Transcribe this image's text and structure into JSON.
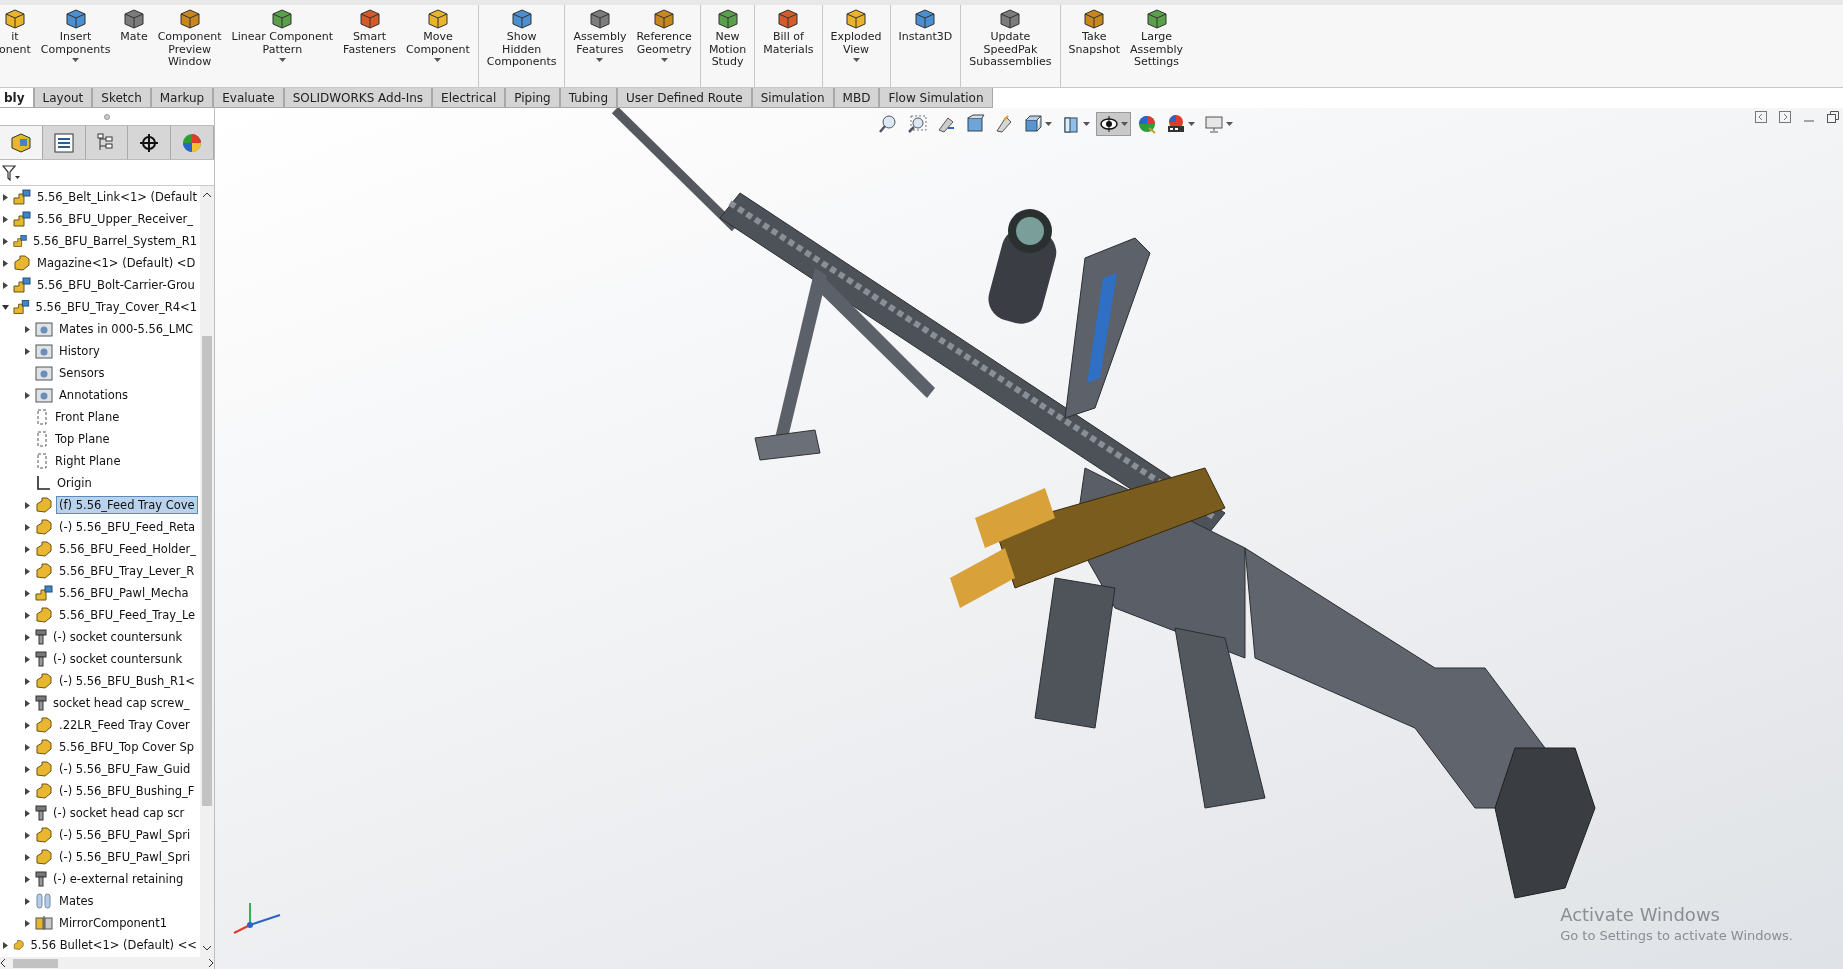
{
  "ribbon": {
    "buttons": [
      {
        "label": [
          "it",
          "onent"
        ],
        "menu": false,
        "separator_after": false
      },
      {
        "label": [
          "Insert",
          "Components"
        ],
        "menu": true,
        "separator_after": false
      },
      {
        "label": [
          "Mate"
        ],
        "menu": false,
        "separator_after": false
      },
      {
        "label": [
          "Component",
          "Preview",
          "Window"
        ],
        "menu": false,
        "separator_after": false
      },
      {
        "label": [
          "Linear Component",
          "Pattern"
        ],
        "menu": true,
        "separator_after": false
      },
      {
        "label": [
          "Smart",
          "Fasteners"
        ],
        "menu": false,
        "separator_after": false
      },
      {
        "label": [
          "Move",
          "Component"
        ],
        "menu": true,
        "separator_after": true
      },
      {
        "label": [
          "Show",
          "Hidden",
          "Components"
        ],
        "menu": false,
        "separator_after": true
      },
      {
        "label": [
          "Assembly",
          "Features"
        ],
        "menu": true,
        "separator_after": false
      },
      {
        "label": [
          "Reference",
          "Geometry"
        ],
        "menu": true,
        "separator_after": true
      },
      {
        "label": [
          "New",
          "Motion",
          "Study"
        ],
        "menu": false,
        "separator_after": true
      },
      {
        "label": [
          "Bill of",
          "Materials"
        ],
        "menu": false,
        "separator_after": true
      },
      {
        "label": [
          "Exploded",
          "View"
        ],
        "menu": true,
        "separator_after": true
      },
      {
        "label": [
          "Instant3D"
        ],
        "menu": false,
        "separator_after": true
      },
      {
        "label": [
          "Update",
          "SpeedPak",
          "Subassemblies"
        ],
        "menu": false,
        "separator_after": true
      },
      {
        "label": [
          "Take",
          "Snapshot"
        ],
        "menu": false,
        "separator_after": false
      },
      {
        "label": [
          "Large",
          "Assembly",
          "Settings"
        ],
        "menu": false,
        "separator_after": false
      }
    ]
  },
  "tabs": [
    {
      "label": "bly",
      "selected": true
    },
    {
      "label": "Layout",
      "selected": false
    },
    {
      "label": "Sketch",
      "selected": false
    },
    {
      "label": "Markup",
      "selected": false
    },
    {
      "label": "Evaluate",
      "selected": false
    },
    {
      "label": "SOLIDWORKS Add-Ins",
      "selected": false
    },
    {
      "label": "Electrical",
      "selected": false
    },
    {
      "label": "Piping",
      "selected": false
    },
    {
      "label": "Tubing",
      "selected": false
    },
    {
      "label": "User Defined Route",
      "selected": false
    },
    {
      "label": "Simulation",
      "selected": false
    },
    {
      "label": "MBD",
      "selected": false
    },
    {
      "label": "Flow Simulation",
      "selected": false
    }
  ],
  "panel_tabs": [
    {
      "selected": true
    },
    {
      "selected": false
    },
    {
      "selected": false
    },
    {
      "selected": false
    },
    {
      "selected": false
    }
  ],
  "tree": [
    {
      "label": "5.56_Belt_Link<1> (Default",
      "kind": "assembly",
      "expanded": false,
      "selected": false
    },
    {
      "label": "5.56_BFU_Upper_Receiver_",
      "kind": "assembly",
      "expanded": false,
      "selected": false
    },
    {
      "label": "5.56_BFU_Barrel_System_R1",
      "kind": "assembly",
      "expanded": false,
      "selected": false
    },
    {
      "label": "Magazine<1> (Default) <D",
      "kind": "part",
      "expanded": false,
      "selected": false
    },
    {
      "label": "5.56_BFU_Bolt-Carrier-Grou",
      "kind": "assembly",
      "expanded": false,
      "selected": false
    },
    {
      "label": "5.56_BFU_Tray_Cover_R4<1",
      "kind": "assembly",
      "expanded": true,
      "selected": false,
      "children": [
        {
          "label": "Mates in 000-5.56_LMC",
          "kind": "folder",
          "expanded": false,
          "selected": false
        },
        {
          "label": "History",
          "kind": "folder",
          "expanded": false,
          "selected": false
        },
        {
          "label": "Sensors",
          "kind": "folder",
          "selected": false
        },
        {
          "label": "Annotations",
          "kind": "folder",
          "expanded": false,
          "selected": false
        },
        {
          "label": "Front Plane",
          "kind": "plane",
          "selected": false
        },
        {
          "label": "Top Plane",
          "kind": "plane",
          "selected": false
        },
        {
          "label": "Right Plane",
          "kind": "plane",
          "selected": false
        },
        {
          "label": "Origin",
          "kind": "origin",
          "selected": false
        },
        {
          "label": "(f) 5.56_Feed Tray Cove",
          "kind": "part",
          "expanded": false,
          "selected": true
        },
        {
          "label": "(-) 5.56_BFU_Feed_Reta",
          "kind": "part",
          "expanded": false,
          "selected": false
        },
        {
          "label": "5.56_BFU_Feed_Holder_",
          "kind": "part",
          "expanded": false,
          "selected": false
        },
        {
          "label": "5.56_BFU_Tray_Lever_R",
          "kind": "part",
          "expanded": false,
          "selected": false
        },
        {
          "label": "5.56_BFU_Pawl_Mecha",
          "kind": "assembly",
          "expanded": false,
          "selected": false
        },
        {
          "label": "5.56_BFU_Feed_Tray_Le",
          "kind": "part",
          "expanded": false,
          "selected": false
        },
        {
          "label": "(-) socket countersunk",
          "kind": "screw",
          "expanded": false,
          "selected": false
        },
        {
          "label": "(-) socket countersunk",
          "kind": "screw",
          "expanded": false,
          "selected": false
        },
        {
          "label": "(-) 5.56_BFU_Bush_R1<",
          "kind": "part",
          "expanded": false,
          "selected": false
        },
        {
          "label": "socket head cap screw_",
          "kind": "screw",
          "expanded": false,
          "selected": false
        },
        {
          "label": ".22LR_Feed Tray Cover",
          "kind": "part",
          "expanded": false,
          "selected": false
        },
        {
          "label": "5.56_BFU_Top Cover Sp",
          "kind": "part",
          "expanded": false,
          "selected": false
        },
        {
          "label": "(-) 5.56_BFU_Faw_Guid",
          "kind": "part",
          "expanded": false,
          "selected": false
        },
        {
          "label": "(-) 5.56_BFU_Bushing_F",
          "kind": "part",
          "expanded": false,
          "selected": false
        },
        {
          "label": "(-) socket head cap scr",
          "kind": "screw",
          "expanded": false,
          "selected": false
        },
        {
          "label": "(-) 5.56_BFU_Pawl_Spri",
          "kind": "part",
          "expanded": false,
          "selected": false
        },
        {
          "label": "(-) 5.56_BFU_Pawl_Spri",
          "kind": "part",
          "expanded": false,
          "selected": false
        },
        {
          "label": "(-) e-external retaining",
          "kind": "screw",
          "expanded": false,
          "selected": false
        },
        {
          "label": "Mates",
          "kind": "mates",
          "expanded": false,
          "selected": false
        },
        {
          "label": "MirrorComponent1",
          "kind": "mirror",
          "expanded": false,
          "selected": false
        }
      ]
    },
    {
      "label": "5.56 Bullet<1> (Default) <<",
      "kind": "part",
      "expanded": false,
      "selected": false
    }
  ],
  "view_toolbar": [
    {
      "menu": false,
      "pressed": false
    },
    {
      "menu": false,
      "pressed": false
    },
    {
      "menu": false,
      "pressed": false
    },
    {
      "menu": false,
      "pressed": false
    },
    {
      "menu": false,
      "pressed": false
    },
    {
      "menu": true,
      "pressed": false
    },
    {
      "menu": true,
      "pressed": false
    },
    {
      "menu": true,
      "pressed": true
    },
    {
      "menu": false,
      "pressed": false
    },
    {
      "menu": true,
      "pressed": false
    },
    {
      "menu": true,
      "pressed": false
    }
  ],
  "os_notice": {
    "title": "Activate Windows",
    "subtitle": "Go to Settings to activate Windows."
  }
}
